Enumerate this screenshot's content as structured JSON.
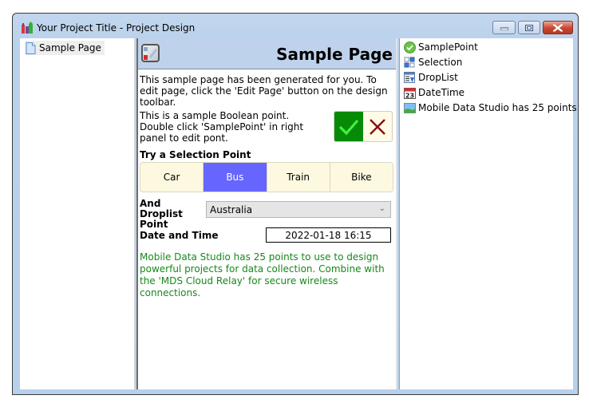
{
  "window": {
    "title": "Your Project Title - Project Design",
    "controls": {
      "minimize": "minimize",
      "maximize": "maximize",
      "close": "close"
    }
  },
  "pages_panel": {
    "items": [
      {
        "label": "Sample Page",
        "icon": "page-icon"
      }
    ]
  },
  "page": {
    "title": "Sample Page",
    "intro": "This sample page has been generated for you.  To edit page, click the 'Edit Page' button on the design toolbar.",
    "boolean_text": "This is a sample Boolean point.  Double click 'SamplePoint' in right panel to edit pont.",
    "boolean_value": true,
    "selection_label": "Try a Selection Point",
    "selection_options": [
      "Car",
      "Bus",
      "Train",
      "Bike"
    ],
    "selection_selected": "Bus",
    "droplist_label": "And Droplist Point",
    "droplist_value": "Australia",
    "datetime_label": "Date and Time",
    "datetime_value": "2022-01-18 16:15",
    "footer_text": "Mobile Data Studio has 25 points to use to design powerful projects for data collection. Combine with the 'MDS Cloud Relay' for secure wireless connections.",
    "colors": {
      "header_bg": "#bfd2ec",
      "selected_option": "#6666ff",
      "bool_yes": "#078a07",
      "footer_text": "#16891a"
    }
  },
  "points_panel": {
    "items": [
      {
        "label": "SamplePoint",
        "icon": "check-circle-icon"
      },
      {
        "label": "Selection",
        "icon": "selection-icon"
      },
      {
        "label": "DropList",
        "icon": "droplist-icon"
      },
      {
        "label": "DateTime",
        "icon": "calendar-icon"
      },
      {
        "label": "Mobile Data Studio has 25 points",
        "icon": "image-icon"
      }
    ]
  }
}
